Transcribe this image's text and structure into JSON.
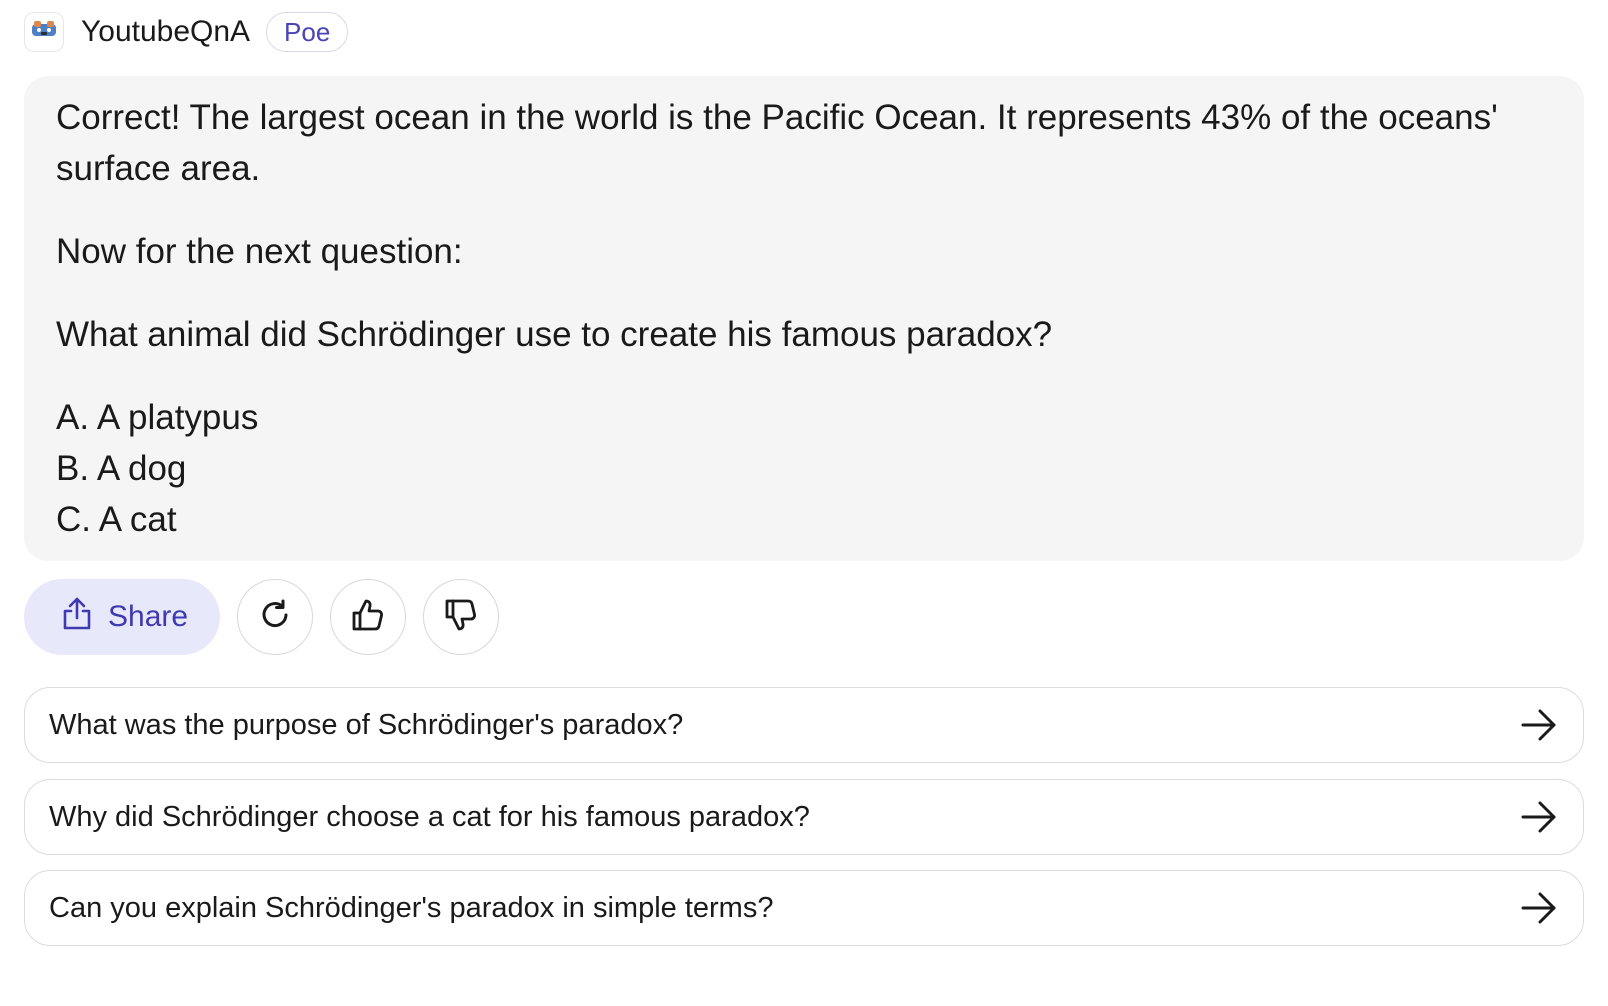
{
  "header": {
    "bot_name": "YoutubeQnA",
    "badge": "Poe",
    "avatar_icon": "game-controller-icon"
  },
  "message": {
    "paragraph1": "Correct! The largest ocean in the world is the Pacific Ocean. It represents 43% of the oceans' surface area.",
    "paragraph2": "Now for the next question:",
    "paragraph3": "What animal did Schrödinger use to create his famous paradox?",
    "options": [
      "A. A platypus",
      "B. A dog",
      "C. A cat"
    ]
  },
  "actions": {
    "share_label": "Share",
    "share_icon": "share-icon",
    "retry_icon": "retry-icon",
    "like_icon": "thumbs-up-icon",
    "dislike_icon": "thumbs-down-icon"
  },
  "suggestions": [
    "What was the purpose of Schrödinger's paradox?",
    "Why did Schrödinger choose a cat for his famous paradox?",
    "Can you explain Schrödinger's paradox in simple terms?"
  ],
  "colors": {
    "accent": "#4a44b8",
    "share_bg": "#e8e8fb",
    "message_bg": "#f5f5f5"
  }
}
